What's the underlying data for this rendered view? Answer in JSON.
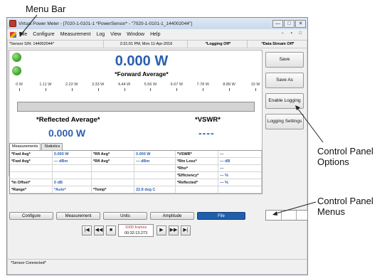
{
  "callouts": {
    "menu_bar": "Menu Bar",
    "control_panel_options_line1": "Control Panel",
    "control_panel_options_line2": "Options",
    "control_panel_menus_line1": "Control Panel",
    "control_panel_menus_line2": "Menus"
  },
  "window": {
    "title": "Virtual Power Meter - [7020-1-0101-1 *PowerSensor* - \"7020-1-0101-1_144002044\"]",
    "controls": [
      "—",
      "□",
      "✕"
    ]
  },
  "menubar": {
    "items": [
      "File",
      "Configure",
      "Measurement",
      "Log",
      "View",
      "Window",
      "Help"
    ],
    "mdi_controls": "– ▪ □"
  },
  "status_top": {
    "sensor": "*Sensor S/N: 144002044*",
    "timestamp": "2:31:01 PM, Mon 11-Apr-2016",
    "logging": "*Logging Off*",
    "data_stream": "*Data Stream Off*"
  },
  "display": {
    "forward_value": "0.000 W",
    "forward_label": "*Forward Average*",
    "scale_ticks": [
      "0 W",
      "1.11 W",
      "2.22 W",
      "3.33 W",
      "4.44 W",
      "5.56 W",
      "6.67 W",
      "7.78 W",
      "8.89 W",
      "10 W"
    ],
    "bar_level": 0,
    "reflected_label": "*Reflected Average*",
    "reflected_value": "0.000 W",
    "vswr_label": "*VSWR*",
    "vswr_value": "----"
  },
  "control_panel": {
    "save": "Save",
    "save_as": "Save As",
    "enable_logging": "Enable Logging",
    "logging_settings": "Logging Settings"
  },
  "tabs": [
    "Measurements",
    "Statistics"
  ],
  "table": {
    "rows": [
      [
        {
          "t": "*Fwd Avg*",
          "k": "lab"
        },
        {
          "t": "0.000 W",
          "k": "val"
        },
        {
          "t": "*Rfl Avg*",
          "k": "lab"
        },
        {
          "t": "0.000 W",
          "k": "val"
        },
        {
          "t": "*VSWR*",
          "k": "lab"
        },
        {
          "t": "—",
          "k": "val"
        }
      ],
      [
        {
          "t": "*Fwd Avg*",
          "k": "lab"
        },
        {
          "t": "— dBm",
          "k": "val"
        },
        {
          "t": "*Rfl Avg*",
          "k": "lab"
        },
        {
          "t": "— dBm",
          "k": "val"
        },
        {
          "t": "*Rtn Loss*",
          "k": "lab"
        },
        {
          "t": "— dB",
          "k": "val"
        }
      ],
      [
        {
          "t": "",
          "k": "lab"
        },
        {
          "t": "",
          "k": "val"
        },
        {
          "t": "",
          "k": "lab"
        },
        {
          "t": "",
          "k": "val"
        },
        {
          "t": "*Rho*",
          "k": "lab"
        },
        {
          "t": "—",
          "k": "val"
        }
      ],
      [
        {
          "t": "",
          "k": "lab"
        },
        {
          "t": "",
          "k": "val"
        },
        {
          "t": "",
          "k": "lab"
        },
        {
          "t": "",
          "k": "val"
        },
        {
          "t": "*Efficiency*",
          "k": "lab"
        },
        {
          "t": "— %",
          "k": "val"
        }
      ],
      [
        {
          "t": "*In Offset*",
          "k": "lab"
        },
        {
          "t": "0 dB",
          "k": "val"
        },
        {
          "t": "",
          "k": "lab"
        },
        {
          "t": "",
          "k": "val"
        },
        {
          "t": "*Reflected*",
          "k": "lab"
        },
        {
          "t": "— %",
          "k": "val"
        }
      ],
      [
        {
          "t": "*Range*",
          "k": "lab"
        },
        {
          "t": "*Auto*",
          "k": "val"
        },
        {
          "t": "*Temp*",
          "k": "lab"
        },
        {
          "t": "22.8 deg C",
          "k": "val"
        },
        {
          "t": "",
          "k": "lab"
        },
        {
          "t": "",
          "k": "val"
        }
      ]
    ]
  },
  "mode_buttons": [
    "Configure",
    "Measurement",
    "Units",
    "Amplitude",
    "File"
  ],
  "mode_active": "File",
  "transport": {
    "buttons": [
      "|◀",
      "◀◀",
      "■",
      "▶",
      "▶▶",
      "▶|"
    ],
    "frames": "1000 frames",
    "time": "00:32:13.273"
  },
  "status_bottom": "*Sensor Connected*",
  "colors": {
    "value_blue": "#2b5fb1",
    "active_tab_blue": "#1f5fae",
    "led_green": "#35a022"
  }
}
